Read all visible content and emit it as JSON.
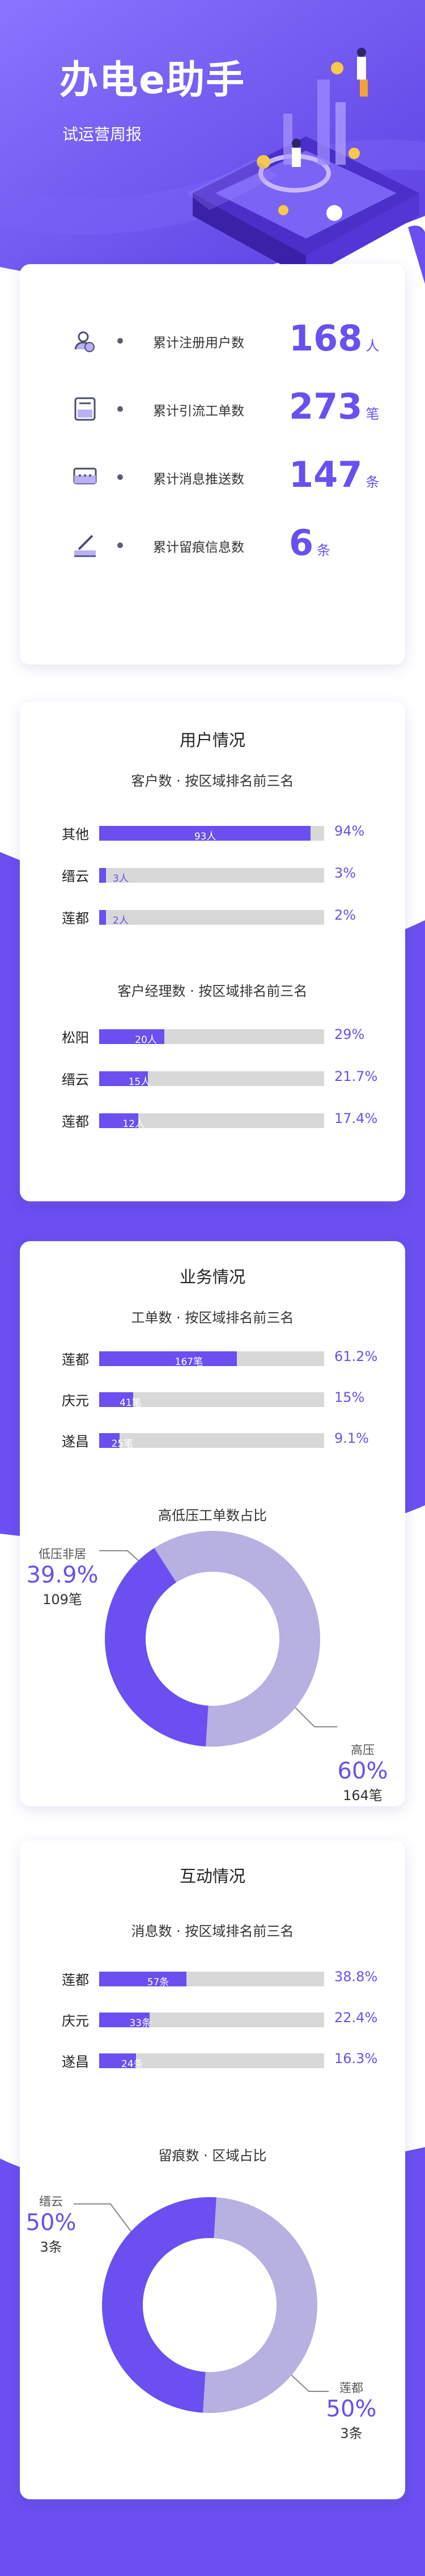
{
  "header": {
    "title": "办电e助手",
    "subtitle": "试运营周报"
  },
  "colors": {
    "accent": "#6b4ff0",
    "light": "#b6b1e0",
    "track": "#d8d8d8"
  },
  "summary": [
    {
      "icon": "users-icon",
      "label": "累计注册用户数",
      "value": "168",
      "unit": "人"
    },
    {
      "icon": "work-order-icon",
      "label": "累计引流工单数",
      "value": "273",
      "unit": "笔"
    },
    {
      "icon": "message-icon",
      "label": "累计消息推送数",
      "value": "147",
      "unit": "条"
    },
    {
      "icon": "sign-icon",
      "label": "累计留痕信息数",
      "value": "6",
      "unit": "条"
    }
  ],
  "user_section": {
    "title": "用户情况",
    "customers": {
      "title": "客户数 · 按区域排名前三名",
      "rows": [
        {
          "name": "其他",
          "count": "93人",
          "pct": "94%",
          "fraction": 0.94
        },
        {
          "name": "缙云",
          "count": "3人",
          "pct": "3%",
          "fraction": 0.03
        },
        {
          "name": "莲都",
          "count": "2人",
          "pct": "2%",
          "fraction": 0.02
        }
      ]
    },
    "managers": {
      "title": "客户经理数 · 按区域排名前三名",
      "rows": [
        {
          "name": "松阳",
          "count": "20人",
          "pct": "29%",
          "fraction": 0.29
        },
        {
          "name": "缙云",
          "count": "15人",
          "pct": "21.7%",
          "fraction": 0.217
        },
        {
          "name": "莲都",
          "count": "12人",
          "pct": "17.4%",
          "fraction": 0.174
        }
      ]
    }
  },
  "business_section": {
    "title": "业务情况",
    "orders": {
      "title": "工单数 · 按区域排名前三名",
      "rows": [
        {
          "name": "莲都",
          "count": "167笔",
          "pct": "61.2%",
          "fraction": 0.612
        },
        {
          "name": "庆元",
          "count": "41笔",
          "pct": "15%",
          "fraction": 0.15
        },
        {
          "name": "遂昌",
          "count": "25笔",
          "pct": "9.1%",
          "fraction": 0.091
        }
      ]
    },
    "ratio": {
      "title": "高低压工单数占比",
      "a": {
        "name": "低压非居",
        "pct": "39.9%",
        "count": "109笔",
        "fraction": 0.399
      },
      "b": {
        "name": "高压",
        "pct": "60%",
        "count": "164笔",
        "fraction": 0.601
      }
    }
  },
  "interaction_section": {
    "title": "互动情况",
    "messages": {
      "title": "消息数 · 按区域排名前三名",
      "rows": [
        {
          "name": "莲都",
          "count": "57条",
          "pct": "38.8%",
          "fraction": 0.388
        },
        {
          "name": "庆元",
          "count": "33条",
          "pct": "22.4%",
          "fraction": 0.224
        },
        {
          "name": "遂昌",
          "count": "24条",
          "pct": "16.3%",
          "fraction": 0.163
        }
      ]
    },
    "ratio": {
      "title": "留痕数 · 区域占比",
      "a": {
        "name": "缙云",
        "pct": "50%",
        "count": "3条",
        "fraction": 0.5
      },
      "b": {
        "name": "莲都",
        "pct": "50%",
        "count": "3条",
        "fraction": 0.5
      }
    }
  }
}
